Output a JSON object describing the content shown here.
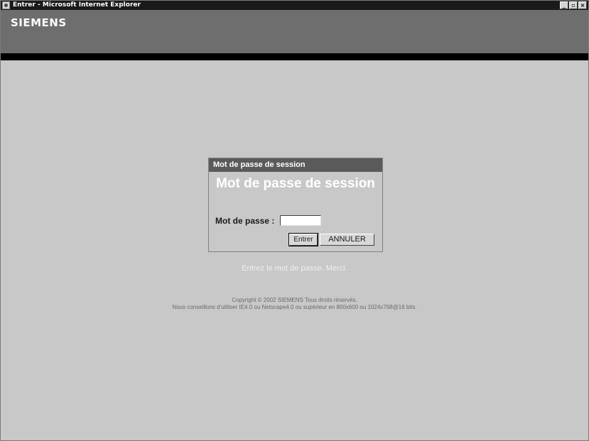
{
  "window": {
    "title": "Entrer - Microsoft Internet Explorer",
    "controls": [
      "_",
      "▫",
      "×"
    ]
  },
  "header": {
    "brand": "SIEMENS"
  },
  "dialog": {
    "header": "Mot de passe de session",
    "title": "Mot de passe de session",
    "password_label": "Mot de passe :",
    "password_value": "",
    "enter_button": "Entrer",
    "cancel_button": "ANNULER"
  },
  "hint": "Entrez le mot de passe. Merci.",
  "footer": {
    "copyright": "Copyright © 2002 SIEMENS Tous droits réservés.",
    "recommendation": "Nous conseillons d'utiliser IE4.0 ou Netscape4.0 ou supérieur en 800x600 ou 1024x768@16 bits."
  },
  "colors": {
    "background": "#c8c8c8",
    "header": "#6e6e6e",
    "dialog_header": "#5a5a5a"
  }
}
